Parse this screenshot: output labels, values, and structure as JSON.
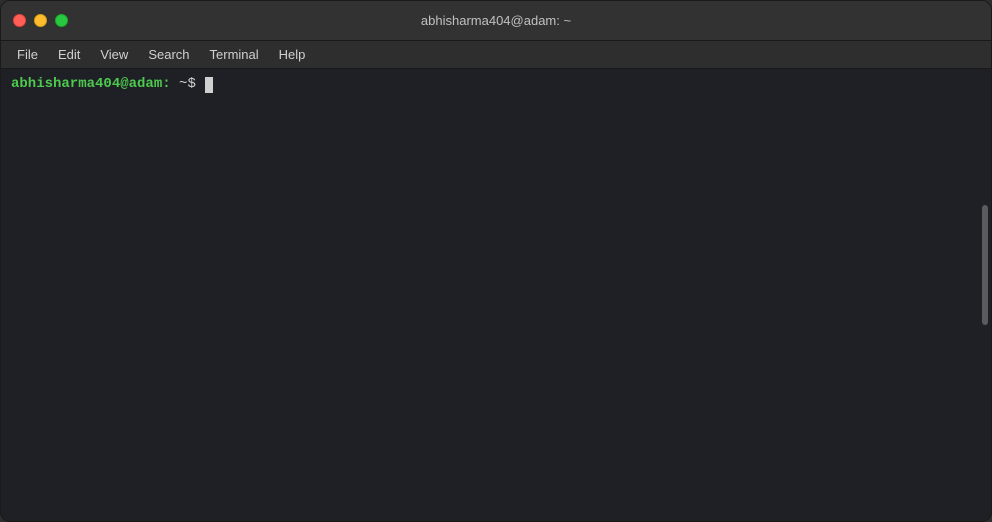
{
  "titlebar": {
    "title": "abhisharma404@adam: ~"
  },
  "controls": {
    "close_label": "close",
    "minimize_label": "minimize",
    "maximize_label": "maximize"
  },
  "menubar": {
    "items": [
      {
        "id": "file",
        "label": "File"
      },
      {
        "id": "edit",
        "label": "Edit"
      },
      {
        "id": "view",
        "label": "View"
      },
      {
        "id": "search",
        "label": "Search"
      },
      {
        "id": "terminal",
        "label": "Terminal"
      },
      {
        "id": "help",
        "label": "Help"
      }
    ]
  },
  "terminal": {
    "prompt": "abhisharma404@adam:~$",
    "prompt_user": "abhisharma404@adam:",
    "prompt_symbol": "~$"
  }
}
